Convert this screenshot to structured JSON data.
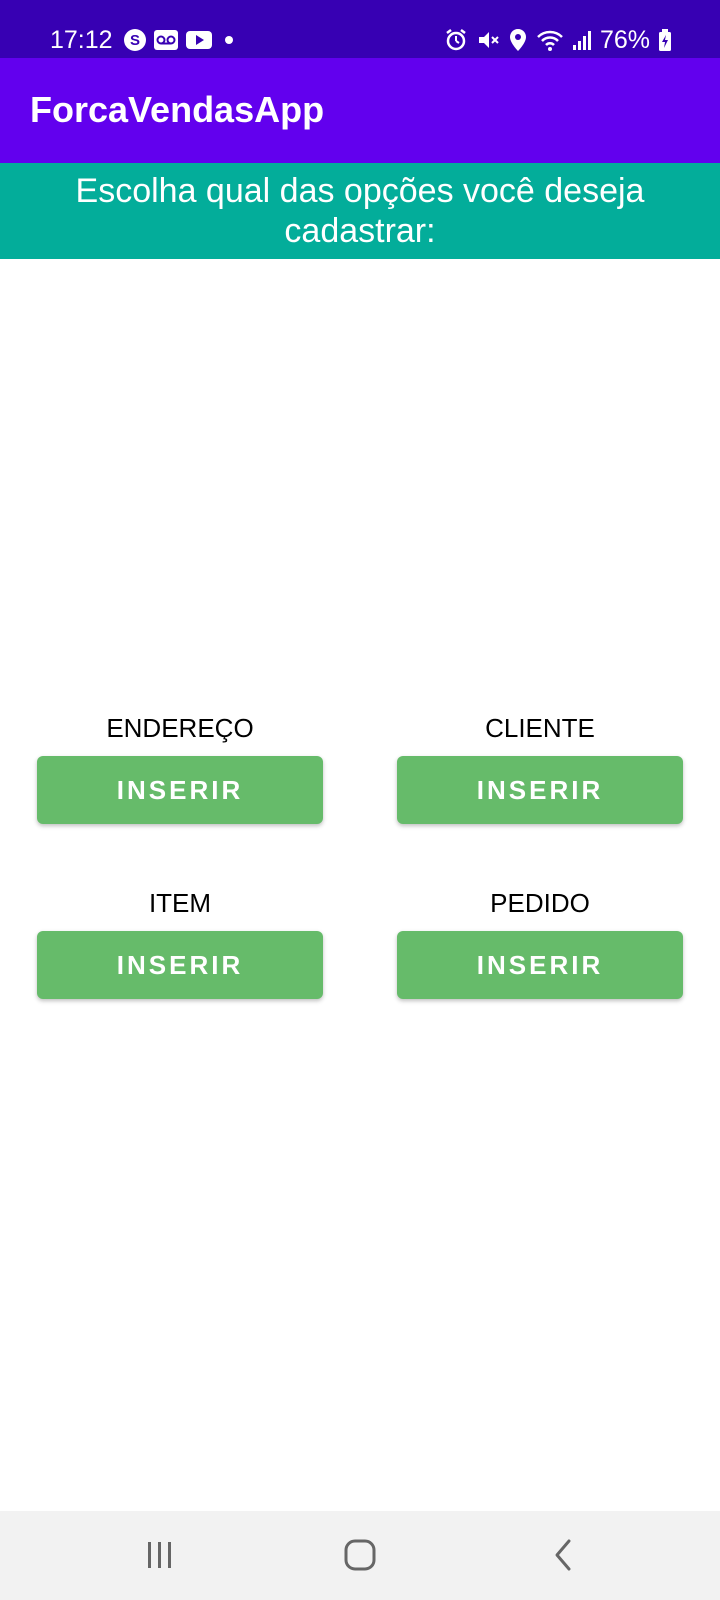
{
  "status_bar": {
    "time": "17:12",
    "battery": "76%",
    "left_icons": [
      "skype-icon",
      "voicemail-icon",
      "youtube-icon",
      "notification-dot-icon"
    ],
    "right_icons": [
      "alarm-icon",
      "mute-icon",
      "location-icon",
      "wifi-icon",
      "signal-icon",
      "battery-icon"
    ]
  },
  "app_bar": {
    "title": "ForcaVendasApp"
  },
  "prompt": {
    "text": "Escolha qual das opções você deseja cadastrar:"
  },
  "options": [
    {
      "label": "ENDEREÇO",
      "button_label": "INSERIR"
    },
    {
      "label": "CLIENTE",
      "button_label": "INSERIR"
    },
    {
      "label": "ITEM",
      "button_label": "INSERIR"
    },
    {
      "label": "PEDIDO",
      "button_label": "INSERIR"
    }
  ],
  "nav_bar": {
    "icons": [
      "recent-apps-icon",
      "home-icon",
      "back-icon"
    ]
  },
  "colors": {
    "status_bar": "#3700b3",
    "app_bar": "#6200ee",
    "prompt_band": "#03ad9a",
    "button": "#66bb6a",
    "nav_bar": "#f2f2f2"
  }
}
